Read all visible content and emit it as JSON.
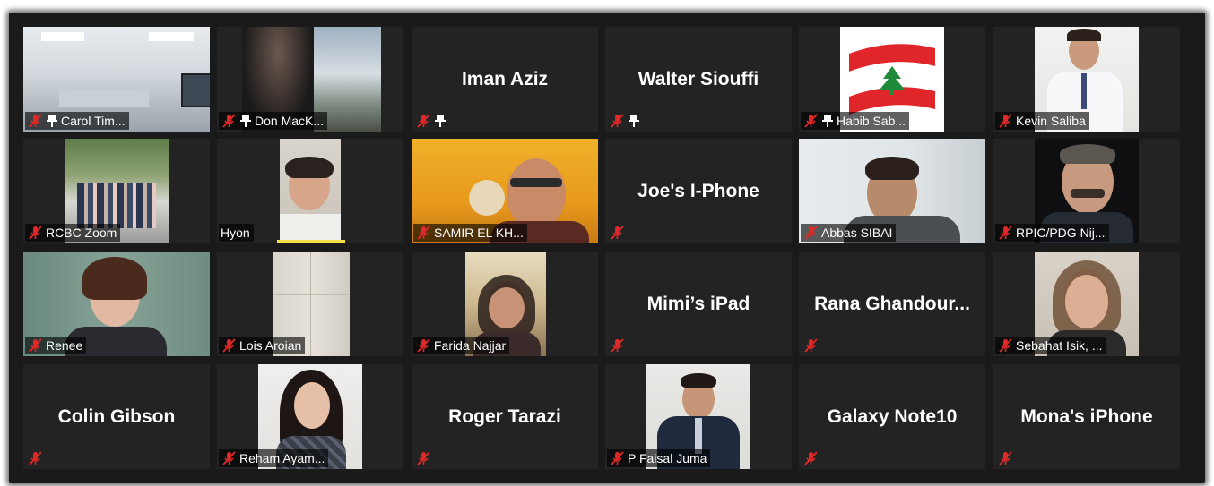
{
  "participants": [
    {
      "name": "Carol Tim...",
      "muted": true,
      "pinned": true,
      "video": true
    },
    {
      "name": "Don MacK...",
      "muted": true,
      "pinned": true,
      "video": true
    },
    {
      "name": "Iman Aziz",
      "muted": true,
      "pinned": true,
      "video": false
    },
    {
      "name": "Walter Siouffi",
      "muted": true,
      "pinned": true,
      "video": false
    },
    {
      "name": "Habib Sab...",
      "muted": true,
      "pinned": true,
      "video": true
    },
    {
      "name": "Kevin Saliba",
      "muted": true,
      "pinned": false,
      "video": true
    },
    {
      "name": "RCBC Zoom",
      "muted": true,
      "pinned": false,
      "video": true
    },
    {
      "name": "Hyon",
      "muted": false,
      "pinned": false,
      "video": true,
      "speaking": true
    },
    {
      "name": "SAMIR EL KH...",
      "muted": true,
      "pinned": false,
      "video": true
    },
    {
      "name": "Joe's I-Phone",
      "muted": true,
      "pinned": false,
      "video": false
    },
    {
      "name": "Abbas SIBAI",
      "muted": true,
      "pinned": false,
      "video": true
    },
    {
      "name": "RPIC/PDG  Nij...",
      "muted": true,
      "pinned": false,
      "video": true
    },
    {
      "name": "Renee",
      "muted": true,
      "pinned": false,
      "video": true
    },
    {
      "name": "Lois Aroian",
      "muted": true,
      "pinned": false,
      "video": true
    },
    {
      "name": "Farida Najjar",
      "muted": true,
      "pinned": false,
      "video": true
    },
    {
      "name": "Mimi’s iPad",
      "muted": true,
      "pinned": false,
      "video": false
    },
    {
      "name": "Rana  Ghandour...",
      "muted": true,
      "pinned": false,
      "video": false
    },
    {
      "name": "Sebahat Isik, ...",
      "muted": true,
      "pinned": false,
      "video": true
    },
    {
      "name": "Colin Gibson",
      "muted": true,
      "pinned": false,
      "video": false
    },
    {
      "name": "Reham Ayam...",
      "muted": true,
      "pinned": false,
      "video": true
    },
    {
      "name": "Roger Tarazi",
      "muted": true,
      "pinned": false,
      "video": false
    },
    {
      "name": "P Faisal Juma",
      "muted": true,
      "pinned": false,
      "video": true
    },
    {
      "name": "Galaxy Note10",
      "muted": true,
      "pinned": false,
      "video": false
    },
    {
      "name": "Mona's iPhone",
      "muted": true,
      "pinned": false,
      "video": false
    }
  ],
  "icons": {
    "muted": "muted-microphone-icon",
    "pinned": "pin-icon"
  },
  "colors": {
    "background": "#1a1a1a",
    "tile": "#232323",
    "muted_icon": "#e02828",
    "speaking_highlight": "#f5e04a"
  }
}
